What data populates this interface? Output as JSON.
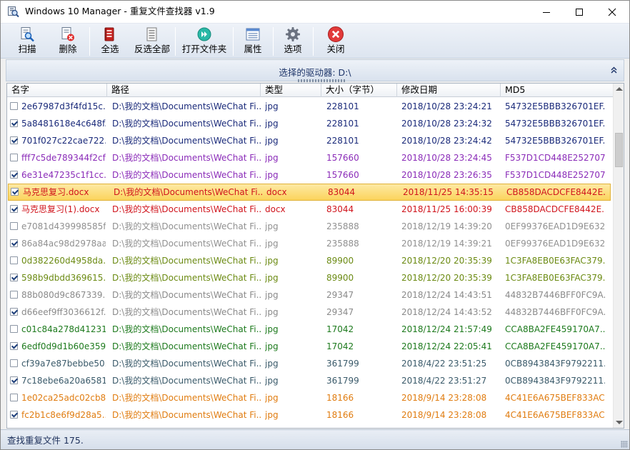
{
  "window": {
    "title": "Windows 10 Manager - 重复文件查找器 v1.9"
  },
  "toolbar": [
    {
      "label": "扫描",
      "icon": "scan-icon"
    },
    {
      "label": "删除",
      "icon": "delete-icon"
    },
    {
      "label": "全选",
      "icon": "select-all-icon"
    },
    {
      "label": "反选全部",
      "icon": "invert-selection-icon"
    },
    {
      "label": "打开文件夹",
      "icon": "open-folder-icon"
    },
    {
      "label": "属性",
      "icon": "properties-icon"
    },
    {
      "label": "选项",
      "icon": "gear-icon"
    },
    {
      "label": "关闭",
      "icon": "close-circle-icon"
    }
  ],
  "drive_bar": {
    "label": "选择的驱动器: D:\\"
  },
  "columns": [
    "名字",
    "路径",
    "类型",
    "大小（字节）",
    "修改日期",
    "MD5"
  ],
  "rows": [
    {
      "checked": false,
      "name": "2e67987d3f4fd15c...",
      "path": "D:\\我的文档\\Documents\\WeChat  Fi...",
      "type": "jpg",
      "size": "228101",
      "date": "2018/10/28 23:24:21",
      "md5": "54732E5BBB326701EF...",
      "color": "#1a2a7a"
    },
    {
      "checked": true,
      "name": "5a8481618e4c648f...",
      "path": "D:\\我的文档\\Documents\\WeChat  Fi...",
      "type": "jpg",
      "size": "228101",
      "date": "2018/10/28 23:24:32",
      "md5": "54732E5BBB326701EF...",
      "color": "#1a2a7a"
    },
    {
      "checked": true,
      "name": "701f027c22cae722...",
      "path": "D:\\我的文档\\Documents\\WeChat  Fi...",
      "type": "jpg",
      "size": "228101",
      "date": "2018/10/28 23:24:42",
      "md5": "54732E5BBB326701EF...",
      "color": "#1a2a7a"
    },
    {
      "checked": false,
      "name": "fff7c5de789344f2cf...",
      "path": "D:\\我的文档\\Documents\\WeChat  Fi...",
      "type": "jpg",
      "size": "157660",
      "date": "2018/10/28 23:24:45",
      "md5": "F537D1CD448E252707...",
      "color": "#8a2bb8"
    },
    {
      "checked": true,
      "name": "6e31e47235c1f1cc...",
      "path": "D:\\我的文档\\Documents\\WeChat  Fi...",
      "type": "jpg",
      "size": "157660",
      "date": "2018/10/28 23:26:35",
      "md5": "F537D1CD448E252707...",
      "color": "#8a2bb8"
    },
    {
      "checked": true,
      "name": "马克思复习.docx",
      "path": "D:\\我的文档\\Documents\\WeChat  Fi...",
      "type": "docx",
      "size": "83044",
      "date": "2018/11/25 14:35:15",
      "md5": "CB858DACDCFE8442E...",
      "color": "#d0141c",
      "selected": true
    },
    {
      "checked": true,
      "name": "马克思复习(1).docx",
      "path": "D:\\我的文档\\Documents\\WeChat  Fi...",
      "type": "docx",
      "size": "83044",
      "date": "2018/11/25 16:00:39",
      "md5": "CB858DACDCFE8442E...",
      "color": "#d0141c"
    },
    {
      "checked": false,
      "name": "e7081d439998585f...",
      "path": "D:\\我的文档\\Documents\\WeChat  Fi...",
      "type": "jpg",
      "size": "235888",
      "date": "2018/12/19 14:39:20",
      "md5": "0EF99376EAD1D9E632...",
      "color": "#909090"
    },
    {
      "checked": true,
      "name": "86a84ac98d2978aa...",
      "path": "D:\\我的文档\\Documents\\WeChat  Fi...",
      "type": "jpg",
      "size": "235888",
      "date": "2018/12/19 14:39:21",
      "md5": "0EF99376EAD1D9E632...",
      "color": "#909090"
    },
    {
      "checked": false,
      "name": "0d382260d4958da...",
      "path": "D:\\我的文档\\Documents\\WeChat  Fi...",
      "type": "jpg",
      "size": "89900",
      "date": "2018/12/20 20:35:39",
      "md5": "1C3FA8EB0E63FAC379...",
      "color": "#6b8a12"
    },
    {
      "checked": true,
      "name": "598b9dbdd369615...",
      "path": "D:\\我的文档\\Documents\\WeChat  Fi...",
      "type": "jpg",
      "size": "89900",
      "date": "2018/12/20 20:35:39",
      "md5": "1C3FA8EB0E63FAC379...",
      "color": "#6b8a12"
    },
    {
      "checked": false,
      "name": "88b080d9c867339...",
      "path": "D:\\我的文档\\Documents\\WeChat  Fi...",
      "type": "jpg",
      "size": "29347",
      "date": "2018/12/24 14:43:51",
      "md5": "44832B7446BFF0FC9A...",
      "color": "#8a8a8a"
    },
    {
      "checked": true,
      "name": "d66eef9ff3036612f...",
      "path": "D:\\我的文档\\Documents\\WeChat  Fi...",
      "type": "jpg",
      "size": "29347",
      "date": "2018/12/24 14:43:52",
      "md5": "44832B7446BFF0FC9A...",
      "color": "#8a8a8a"
    },
    {
      "checked": false,
      "name": "c01c84a278d41231...",
      "path": "D:\\我的文档\\Documents\\WeChat  Fi...",
      "type": "jpg",
      "size": "17042",
      "date": "2018/12/24 21:57:49",
      "md5": "CCA8BA2FE459170A7...",
      "color": "#1d7a1d"
    },
    {
      "checked": true,
      "name": "6edf0d9d1b60e359...",
      "path": "D:\\我的文档\\Documents\\WeChat  Fi...",
      "type": "jpg",
      "size": "17042",
      "date": "2018/12/24 22:05:41",
      "md5": "CCA8BA2FE459170A7...",
      "color": "#1d7a1d"
    },
    {
      "checked": false,
      "name": "cf39a7e87bebbe50...",
      "path": "D:\\我的文档\\Documents\\WeChat  Fi...",
      "type": "jpg",
      "size": "361799",
      "date": "2018/4/22 23:51:25",
      "md5": "0CB8943843F9792211...",
      "color": "#3a5a6a"
    },
    {
      "checked": true,
      "name": "7c18ebe6a20a6581...",
      "path": "D:\\我的文档\\Documents\\WeChat  Fi...",
      "type": "jpg",
      "size": "361799",
      "date": "2018/4/22 23:51:27",
      "md5": "0CB8943843F9792211...",
      "color": "#3a5a6a"
    },
    {
      "checked": false,
      "name": "1e02ca25adc02cb8...",
      "path": "D:\\我的文档\\Documents\\WeChat  Fi...",
      "type": "jpg",
      "size": "18166",
      "date": "2018/9/14 23:28:08",
      "md5": "4C41E6A675BEF833AC...",
      "color": "#e07c10"
    },
    {
      "checked": true,
      "name": "fc2b1c8e6f9d28a5...",
      "path": "D:\\我的文档\\Documents\\WeChat  Fi...",
      "type": "jpg",
      "size": "18166",
      "date": "2018/9/14 23:28:08",
      "md5": "4C41E6A675BEF833AC...",
      "color": "#e07c10"
    }
  ],
  "status": {
    "text": "查找重复文件 175."
  }
}
